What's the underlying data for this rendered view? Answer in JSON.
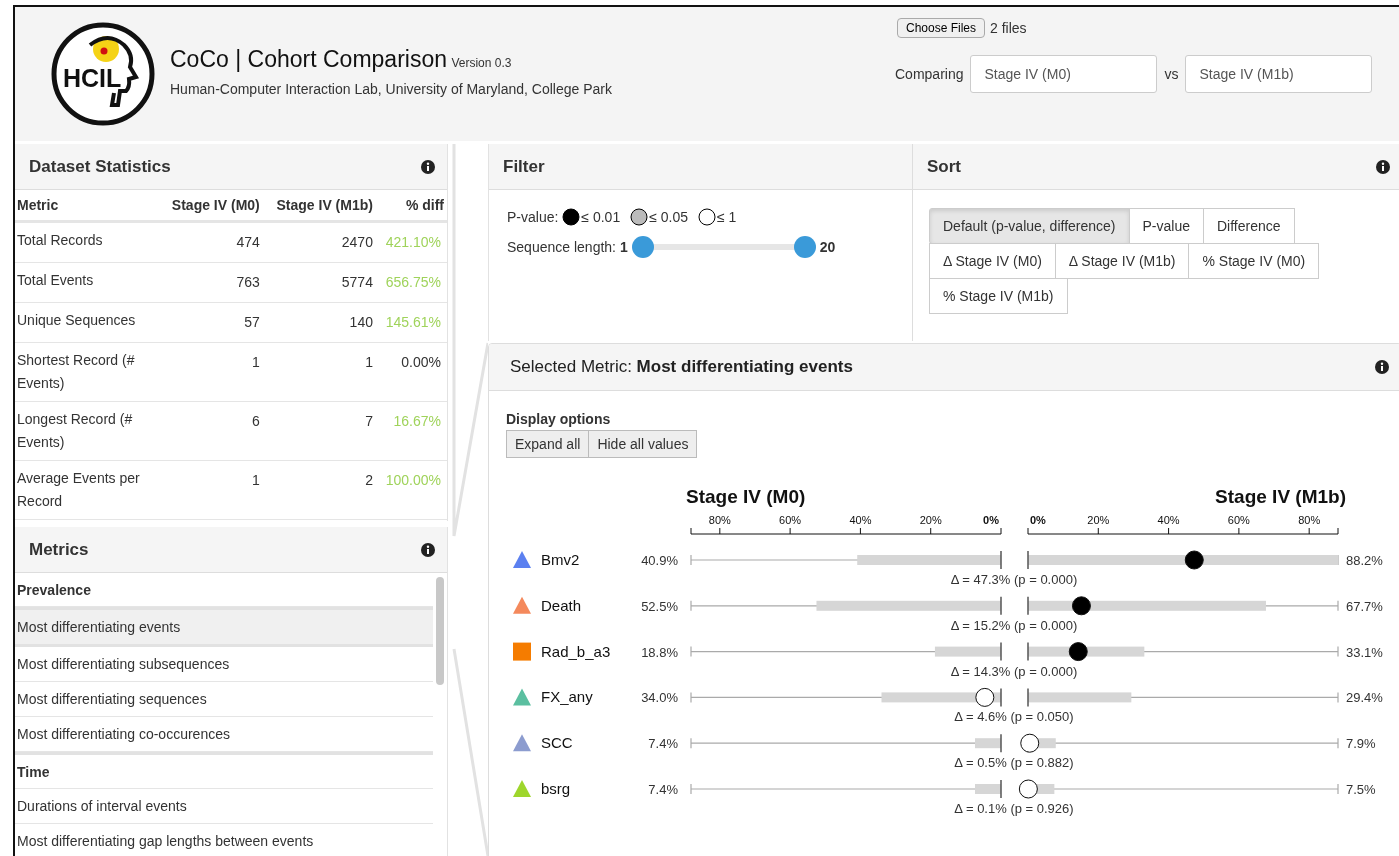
{
  "header": {
    "logo_text": "HCIL",
    "title": "CoCo | Cohort Comparison",
    "version": "Version 0.3",
    "subtitle": "Human-Computer Interaction Lab, University of Maryland, College Park",
    "file_button": "Choose Files",
    "file_status": "2 files",
    "comparing_label": "Comparing",
    "cohort_a": "Stage IV (M0)",
    "vs_label": "vs",
    "cohort_b": "Stage IV (M1b)"
  },
  "dataset_statistics": {
    "title": "Dataset Statistics",
    "columns": [
      "Metric",
      "Stage IV (M0)",
      "Stage IV (M1b)",
      "% diff"
    ],
    "rows": [
      {
        "cells": [
          "Total Records",
          "474",
          "2470",
          "421.10%"
        ],
        "highlight": true
      },
      {
        "cells": [
          "Total Events",
          "763",
          "5774",
          "656.75%"
        ],
        "highlight": true
      },
      {
        "cells": [
          "Unique Sequences",
          "57",
          "140",
          "145.61%"
        ],
        "highlight": true
      },
      {
        "cells": [
          "Shortest Record (# Events)",
          "1",
          "1",
          "0.00%"
        ],
        "highlight": false
      },
      {
        "cells": [
          "Longest Record (# Events)",
          "6",
          "7",
          "16.67%"
        ],
        "highlight": true
      },
      {
        "cells": [
          "Average Events per Record",
          "1",
          "2",
          "100.00%"
        ],
        "highlight": true
      }
    ]
  },
  "metrics": {
    "title": "Metrics",
    "items": [
      {
        "kind": "group",
        "label": "Prevalence",
        "selected": false
      },
      {
        "kind": "metric",
        "label": "Most differentiating events",
        "selected": true
      },
      {
        "kind": "metric",
        "label": "Most differentiating subsequences",
        "selected": false
      },
      {
        "kind": "metric",
        "label": "Most differentiating sequences",
        "selected": false
      },
      {
        "kind": "metric",
        "label": "Most differentiating co-occurences",
        "selected": false
      },
      {
        "kind": "group",
        "label": "Time",
        "selected": false
      },
      {
        "kind": "metric",
        "label": "Durations of interval events",
        "selected": false
      },
      {
        "kind": "metric",
        "label": "Most differentiating gap lengths between events",
        "selected": false
      }
    ]
  },
  "filter": {
    "title": "Filter",
    "pvalue_label": "P-value:",
    "pvalue_options": [
      {
        "color": "#000000",
        "label": "≤ 0.01"
      },
      {
        "color": "#bbbbbb",
        "label": "≤ 0.05"
      },
      {
        "color": "#ffffff",
        "label": "≤ 1"
      }
    ],
    "length_label": "Sequence length:",
    "length_min": "1",
    "length_max": "20",
    "thumbs": [
      {
        "level": 0
      },
      {
        "level": 1
      }
    ]
  },
  "sort": {
    "title": "Sort",
    "options": [
      {
        "label": "Default (p-value, difference)",
        "selected": true
      },
      {
        "label": "P-value",
        "selected": false
      },
      {
        "label": "Difference",
        "selected": false
      },
      {
        "label": "Δ Stage IV (M0)",
        "selected": false
      },
      {
        "label": "Δ Stage IV (M1b)",
        "selected": false
      },
      {
        "label": "% Stage IV (M0)",
        "selected": false
      },
      {
        "label": "% Stage IV (M1b)",
        "selected": false
      }
    ]
  },
  "selected_metric": {
    "title": "Selected Metric: **Most differentiating events**",
    "display_options_label": "Display options",
    "buttons": [
      "Expand all",
      "Hide all values"
    ],
    "comparison": {
      "left_title": "Stage IV (M0)",
      "right_title": "Stage IV (M1b)",
      "left_ticks": [
        "80%",
        "60%",
        "40%",
        "20%",
        "0%"
      ],
      "right_ticks": [
        "0%",
        "20%",
        "40%",
        "60%",
        "80%"
      ],
      "events": [
        {
          "name": "Bmv2",
          "kind": "triangle",
          "color": "#5b80f0",
          "significant": true,
          "left_value": "40.9%",
          "right_value": "88.2%",
          "difference": "Δ = 47.3% (p = 0.000)"
        },
        {
          "name": "Death",
          "kind": "triangle",
          "color": "#f4895c",
          "significant": true,
          "left_value": "52.5%",
          "right_value": "67.7%",
          "difference": "Δ = 15.2% (p = 0.000)"
        },
        {
          "name": "Rad_b_a3",
          "kind": "square",
          "color": "#f57c00",
          "significant": true,
          "left_value": "18.8%",
          "right_value": "33.1%",
          "difference": "Δ = 14.3% (p = 0.000)"
        },
        {
          "name": "FX_any",
          "kind": "triangle",
          "color": "#5bbfa0",
          "significant": false,
          "left_value": "34.0%",
          "right_value": "29.4%",
          "difference": "Δ = 4.6% (p = 0.050)"
        },
        {
          "name": "SCC",
          "kind": "triangle",
          "color": "#8c9ccf",
          "significant": false,
          "left_value": "7.4%",
          "right_value": "7.9%",
          "difference": "Δ = 0.5% (p = 0.882)"
        },
        {
          "name": "bsrg",
          "kind": "triangle",
          "color": "#9ed62c",
          "significant": false,
          "left_value": "7.4%",
          "right_value": "7.5%",
          "difference": "Δ = 0.1% (p = 0.926)"
        }
      ]
    }
  }
}
